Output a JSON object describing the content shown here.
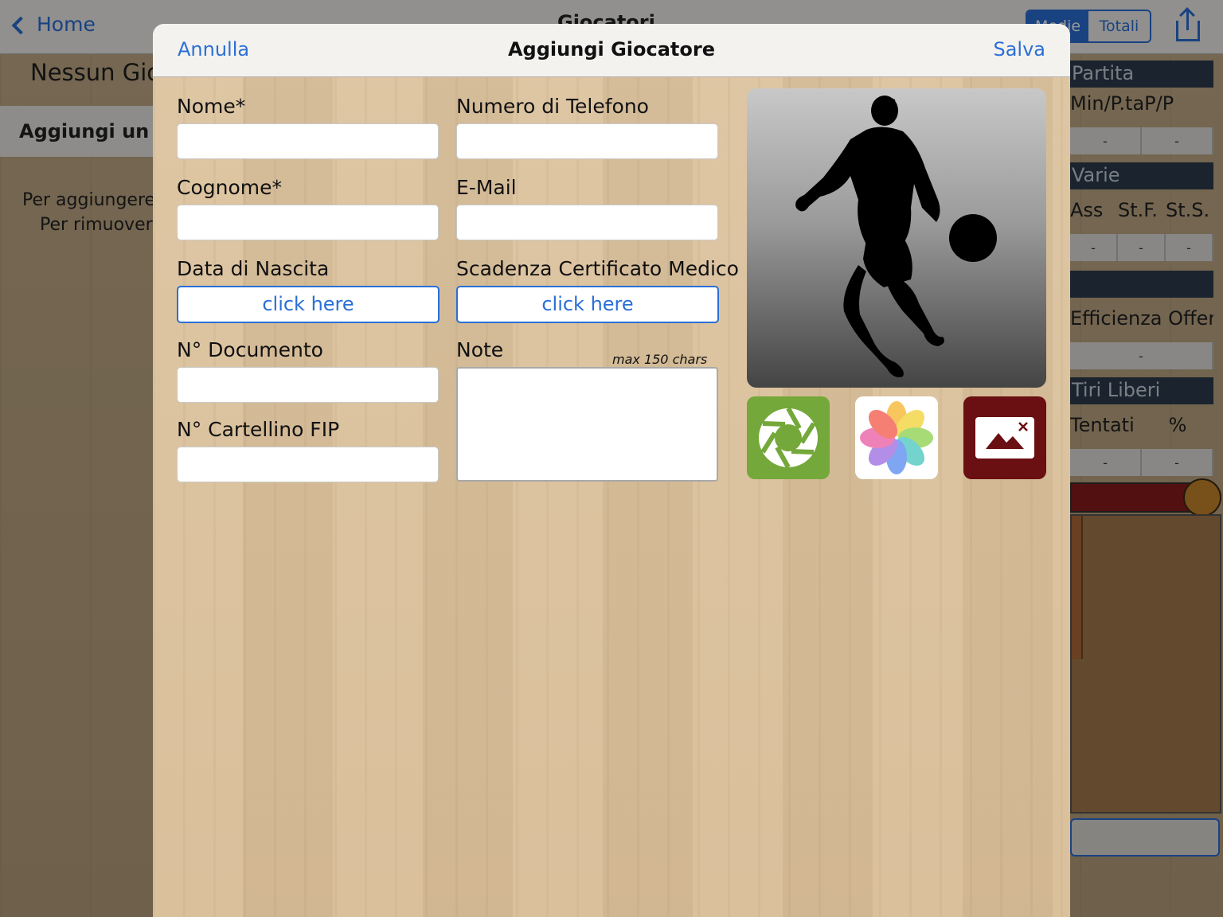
{
  "background": {
    "nav": {
      "back_label": "Home",
      "title": "Giocatori",
      "segment": [
        "Medie",
        "Totali"
      ]
    },
    "left": {
      "title": "Nessun Giocatore",
      "add_button": "Aggiungi un giocatore",
      "help_line1": "Per aggiungere",
      "help_line2": "Per rimuovere"
    },
    "right": {
      "section1": "Partita",
      "cols1": [
        "Min/P.ta",
        "P/P"
      ],
      "vals1": [
        "-",
        "-"
      ],
      "section2": "Varie",
      "cols2": [
        "Ass",
        "St.F.",
        "St.S."
      ],
      "vals2": [
        "-",
        "-",
        "-"
      ],
      "section3": "Efficienza Offensiva",
      "vals3": [
        "-"
      ],
      "section4": "Tiri Liberi",
      "cols4": [
        "Tentati",
        "%"
      ],
      "vals4": [
        "-",
        "-"
      ]
    }
  },
  "modal": {
    "nav": {
      "cancel": "Annulla",
      "title": "Aggiungi Giocatore",
      "save": "Salva"
    },
    "fields": {
      "nome": {
        "label": "Nome*",
        "value": ""
      },
      "cognome": {
        "label": "Cognome*",
        "value": ""
      },
      "data_nascita": {
        "label": "Data di Nascita",
        "button": "click here"
      },
      "documento": {
        "label": "N° Documento",
        "value": ""
      },
      "cartellino": {
        "label": "N° Cartellino FIP",
        "value": ""
      },
      "telefono": {
        "label": "Numero di Telefono",
        "value": ""
      },
      "email": {
        "label": "E-Mail",
        "value": ""
      },
      "certificato": {
        "label": "Scadenza Certificato Medico",
        "button": "click here"
      },
      "note": {
        "label": "Note",
        "hint": "max 150 chars",
        "value": ""
      }
    },
    "photo": {
      "icon": "player-silhouette-icon"
    },
    "actions": {
      "camera_icon": "camera-shutter-icon",
      "library_icon": "photos-library-icon",
      "remove_icon": "remove-image-icon"
    },
    "colors": {
      "accent": "#2a6fd6",
      "camera": "#74a83a",
      "remove": "#6a0f12"
    }
  }
}
